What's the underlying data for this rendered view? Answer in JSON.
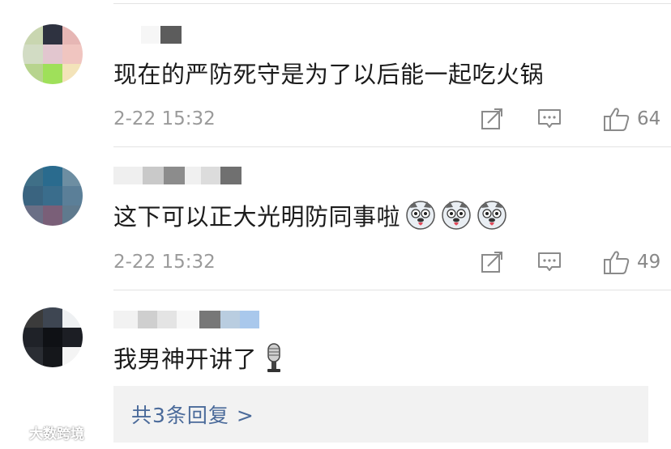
{
  "comments": [
    {
      "text": "现在的严防死守是为了以后能一起吃火锅",
      "time": "2-22 15:32",
      "likes": "64",
      "avatar_icon": "pixelated-avatar"
    },
    {
      "text": "这下可以正大光明防同事啦",
      "time": "2-22 15:32",
      "likes": "49",
      "avatar_icon": "pixelated-avatar",
      "emojis": [
        "husky-emoji",
        "husky-emoji",
        "husky-emoji"
      ]
    },
    {
      "text": "我男神开讲了",
      "avatar_icon": "pixelated-avatar",
      "emojis": [
        "microphone-emoji"
      ]
    }
  ],
  "replies_link": "共3条回复 >",
  "watermark": "大数跨境",
  "icons": {
    "share": "share-icon",
    "comment": "comment-icon",
    "like": "thumbs-up-icon"
  },
  "colors": {
    "link": "#4a6a9a",
    "meta": "#9a9a9a",
    "reply_bg": "#f2f2f2"
  }
}
